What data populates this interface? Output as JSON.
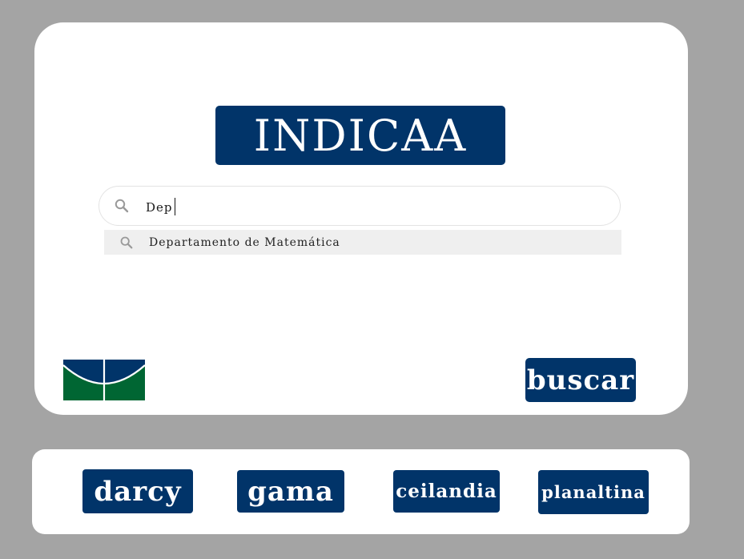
{
  "header": {
    "title": "INDICAA"
  },
  "search": {
    "value": "Dep",
    "icon": "search-icon",
    "suggestions": [
      {
        "label": "Departamento de Matemática",
        "icon": "search-icon"
      }
    ]
  },
  "logo": {
    "name": "unb-logo",
    "colors": {
      "top": "#013469",
      "bottom": "#006633"
    }
  },
  "actions": {
    "search_label": "buscar"
  },
  "campuses": [
    {
      "label": "darcy"
    },
    {
      "label": "gama"
    },
    {
      "label": "ceilandia"
    },
    {
      "label": "planaltina"
    }
  ],
  "colors": {
    "primary": "#013469",
    "background": "#a4a4a4",
    "card": "#ffffff"
  }
}
